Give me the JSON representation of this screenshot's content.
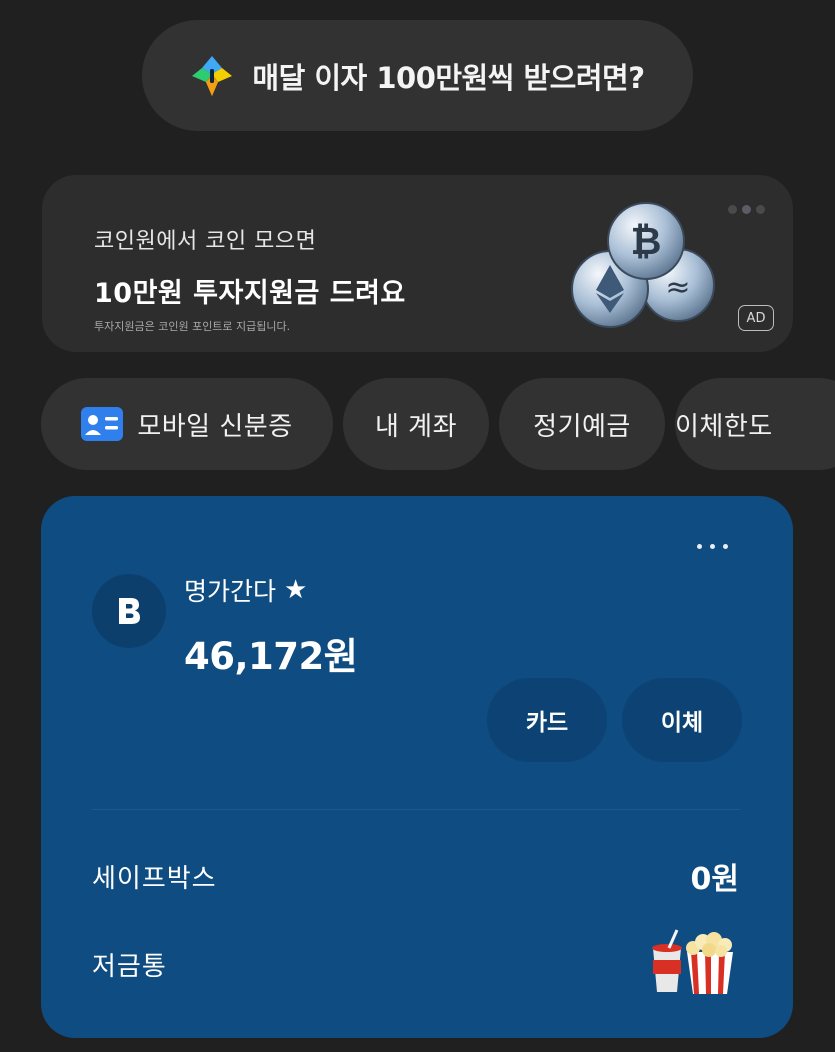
{
  "promo": {
    "text": "매달 이자 100만원씩 받으려면?",
    "icon": "sparkle-icon",
    "colors": {
      "top": "#3fa9f5",
      "left": "#2ecc71",
      "right": "#f5d000",
      "bottom": "#f5a623"
    }
  },
  "ad": {
    "line1": "코인원에서 코인 모으면",
    "line2": "10만원 투자지원금 드려요",
    "line3": "투자지원금은 코인원 포인트로 지급됩니다.",
    "badge": "AD",
    "carousel_dots": 3,
    "active_dot": 2,
    "image": "crypto-coins-image"
  },
  "chips": [
    {
      "label": "모바일 신분증",
      "icon": "id-card-icon"
    },
    {
      "label": "내 계좌"
    },
    {
      "label": "정기예금"
    },
    {
      "label": "이체한도"
    }
  ],
  "account": {
    "name": "명가간다",
    "favorite_icon": "star-icon",
    "balance": "46,172원",
    "logo_letter": "B",
    "card_button": "카드",
    "transfer_button": "이체",
    "safebox_label": "세이프박스",
    "safebox_value": "0원",
    "piggybank_label": "저금통",
    "piggybank_icon": "popcorn-drink-icon",
    "bg_color": "#0f4c81"
  }
}
